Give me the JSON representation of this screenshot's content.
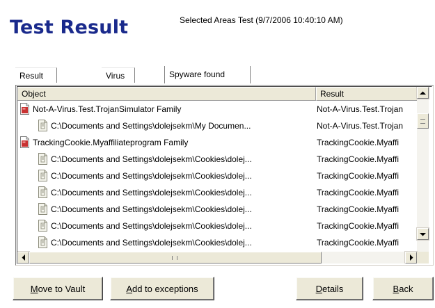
{
  "header": {
    "title": "Test Result",
    "subtitle": "Selected Areas Test (9/7/2006 10:40:10 AM)"
  },
  "tabs": [
    {
      "label": "Result overview",
      "active": false
    },
    {
      "label": "Virus results",
      "active": false
    },
    {
      "label": "Spyware found",
      "active": true
    }
  ],
  "table": {
    "columns": [
      "Object",
      "Result"
    ],
    "rows": [
      {
        "kind": "family",
        "object": "Not-A-Virus.Test.TrojanSimulator Family",
        "result": "Not-A-Virus.Test.Trojan"
      },
      {
        "kind": "child",
        "object": "C:\\Documents and Settings\\dolejsekm\\My Documen...",
        "result": "Not-A-Virus.Test.Trojan"
      },
      {
        "kind": "family",
        "object": "TrackingCookie.Myaffiliateprogram Family",
        "result": "TrackingCookie.Myaffi"
      },
      {
        "kind": "child",
        "object": "C:\\Documents and Settings\\dolejsekm\\Cookies\\dolej...",
        "result": "TrackingCookie.Myaffi"
      },
      {
        "kind": "child",
        "object": "C:\\Documents and Settings\\dolejsekm\\Cookies\\dolej...",
        "result": "TrackingCookie.Myaffi"
      },
      {
        "kind": "child",
        "object": "C:\\Documents and Settings\\dolejsekm\\Cookies\\dolej...",
        "result": "TrackingCookie.Myaffi"
      },
      {
        "kind": "child",
        "object": "C:\\Documents and Settings\\dolejsekm\\Cookies\\dolej...",
        "result": "TrackingCookie.Myaffi"
      },
      {
        "kind": "child",
        "object": "C:\\Documents and Settings\\dolejsekm\\Cookies\\dolej...",
        "result": "TrackingCookie.Myaffi"
      },
      {
        "kind": "child",
        "object": "C:\\Documents and Settings\\dolejsekm\\Cookies\\dolej...",
        "result": "TrackingCookie.Myaffi"
      }
    ]
  },
  "icons": {
    "family": "red-document-icon",
    "child": "blank-document-icon",
    "scroll_up": "scroll-up-arrow-icon",
    "scroll_down": "scroll-down-arrow-icon",
    "scroll_left": "scroll-left-arrow-icon",
    "scroll_right": "scroll-right-arrow-icon"
  },
  "buttons": {
    "vault": {
      "label": "Move to Vault",
      "accel": "M",
      "rest": "ove to Vault"
    },
    "exceptions": {
      "label": "Add to exceptions",
      "accel": "A",
      "rest": "dd to exceptions"
    },
    "details": {
      "label": "Details",
      "accel": "D",
      "rest": "etails"
    },
    "back": {
      "label": "Back",
      "accel": "B",
      "rest": "ack"
    }
  },
  "colors": {
    "title": "#1a2a8c",
    "button_face": "#ece9d8",
    "family_icon": "#c83232"
  }
}
